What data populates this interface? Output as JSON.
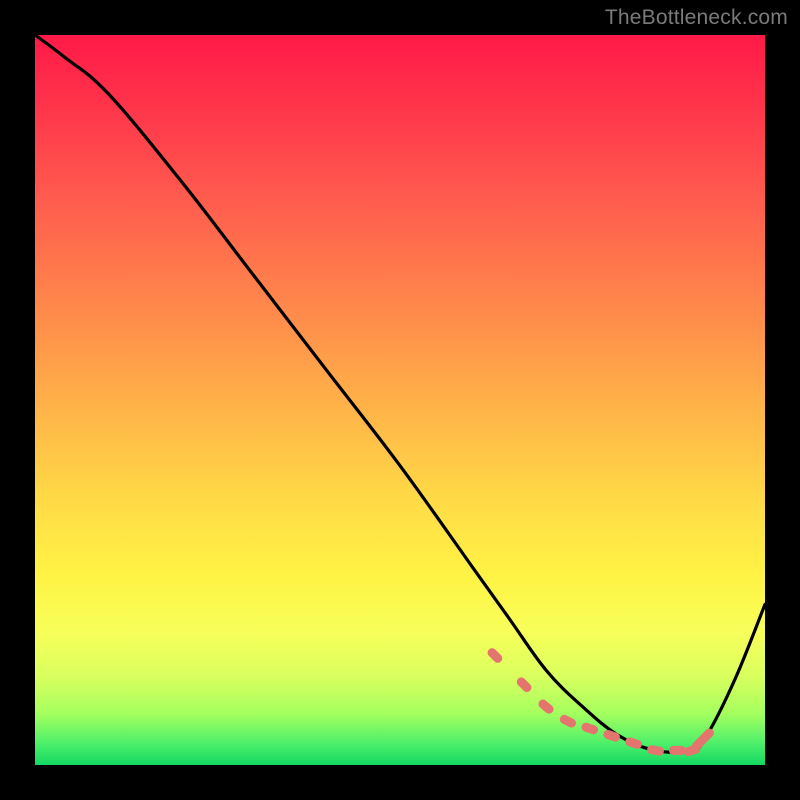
{
  "watermark": "TheBottleneck.com",
  "chart_data": {
    "type": "line",
    "title": "",
    "xlabel": "",
    "ylabel": "",
    "xlim": [
      0,
      100
    ],
    "ylim": [
      0,
      100
    ],
    "series": [
      {
        "name": "bottleneck-curve",
        "x": [
          0,
          4,
          10,
          20,
          30,
          40,
          50,
          60,
          65,
          70,
          75,
          80,
          85,
          90,
          92,
          96,
          100
        ],
        "values": [
          100,
          97,
          92,
          80,
          67,
          54,
          41,
          27,
          20,
          13,
          8,
          4,
          2,
          2,
          4,
          12,
          22
        ]
      }
    ],
    "markers": {
      "name": "valley-markers",
      "color": "#e4746e",
      "x": [
        63,
        67,
        70,
        73,
        76,
        79,
        82,
        85,
        88,
        90,
        91,
        92
      ],
      "values": [
        15,
        11,
        8,
        6,
        5,
        4,
        3,
        2,
        2,
        2,
        3,
        4
      ]
    }
  }
}
